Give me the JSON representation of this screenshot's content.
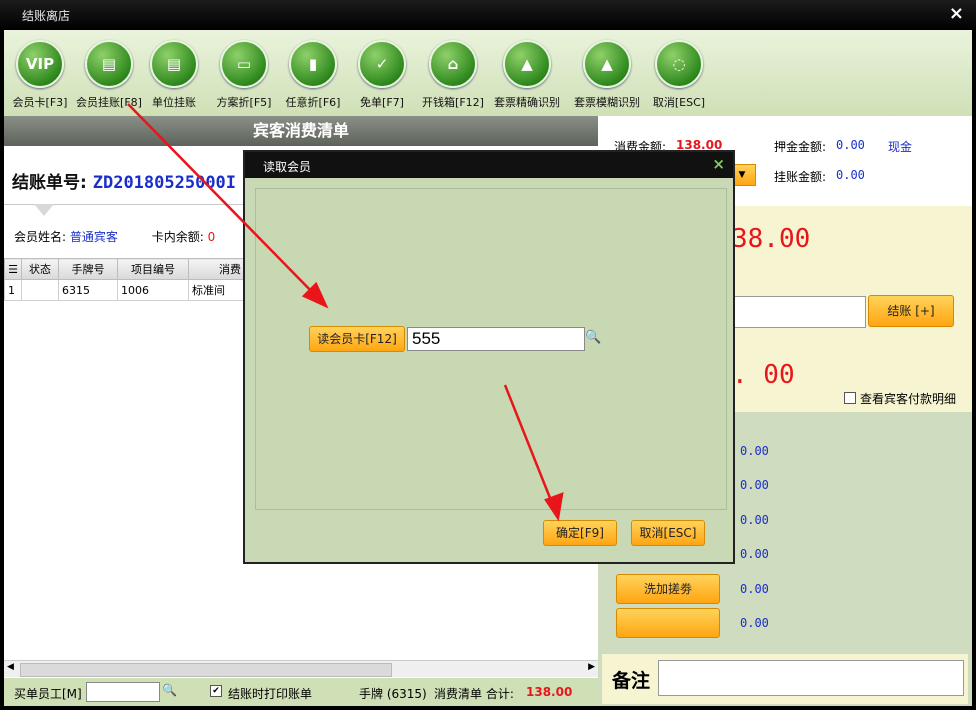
{
  "window": {
    "title": "结账离店",
    "close": "×"
  },
  "toolbar": [
    {
      "label": "会员卡[F3]",
      "glyph": "VIP"
    },
    {
      "label": "会员挂账[F8]",
      "glyph": "▤"
    },
    {
      "label": "单位挂账",
      "glyph": "▤"
    },
    {
      "label": "方案折[F5]",
      "glyph": "▭"
    },
    {
      "label": "任意折[F6]",
      "glyph": "▮"
    },
    {
      "label": "免单[F7]",
      "glyph": "✓"
    },
    {
      "label": "开钱箱[F12]",
      "glyph": "⌂"
    },
    {
      "label": "套票精确识别",
      "glyph": "▲"
    },
    {
      "label": "套票模糊识别",
      "glyph": "▲"
    },
    {
      "label": "取消[ESC]",
      "glyph": "◌"
    }
  ],
  "left": {
    "header": "宾客消费清单",
    "bill_label": "结账单号:",
    "bill_no": "ZD20180525000I",
    "member_name_label": "会员姓名:",
    "member_name": "普通宾客",
    "card_balance_label": "卡内余额:",
    "card_balance": "0",
    "columns": [
      "☰",
      "状态",
      "手牌号",
      "项目编号",
      "消费"
    ],
    "rows": [
      {
        "idx": "1",
        "status": "",
        "tag": "6315",
        "item": "1006",
        "desc": "标准间"
      }
    ]
  },
  "bottom": {
    "buy_staff_label": "买单员工[M]",
    "print_label": "结账时打印账单",
    "summary_tag": "手牌 (6315)",
    "summary_text": "消费清单 合计:",
    "summary_total": "138.00"
  },
  "right": {
    "consume_label": "消费金额:",
    "consume_value": "138.00",
    "deposit_label": "押金金额:",
    "deposit_value": "0.00",
    "cash_label": "现金",
    "credit_label": "挂账金额:",
    "credit_value": "0.00",
    "big_amount_1": "38.00",
    "big_amount_2": ". 00",
    "checkout_button": "结账 [+]",
    "view_detail_label": "查看宾客付款明细",
    "pay_values": [
      "0.00",
      "0.00",
      "0.00",
      "0.00",
      "0.00",
      "0.00"
    ],
    "coupon_button": "洗加搓劵",
    "remark_label": "备注"
  },
  "dialog": {
    "title": "读取会员",
    "close": "×",
    "read_button": "读会员卡[F12]",
    "card_value": "555",
    "ok_button": "确定[F9]",
    "cancel_button": "取消[ESC]"
  },
  "colors": {
    "accent_red": "#e8161a",
    "link_blue": "#1a2fc9",
    "toolbar_green": "#2f8a1e",
    "button_orange": "#ffa512"
  }
}
